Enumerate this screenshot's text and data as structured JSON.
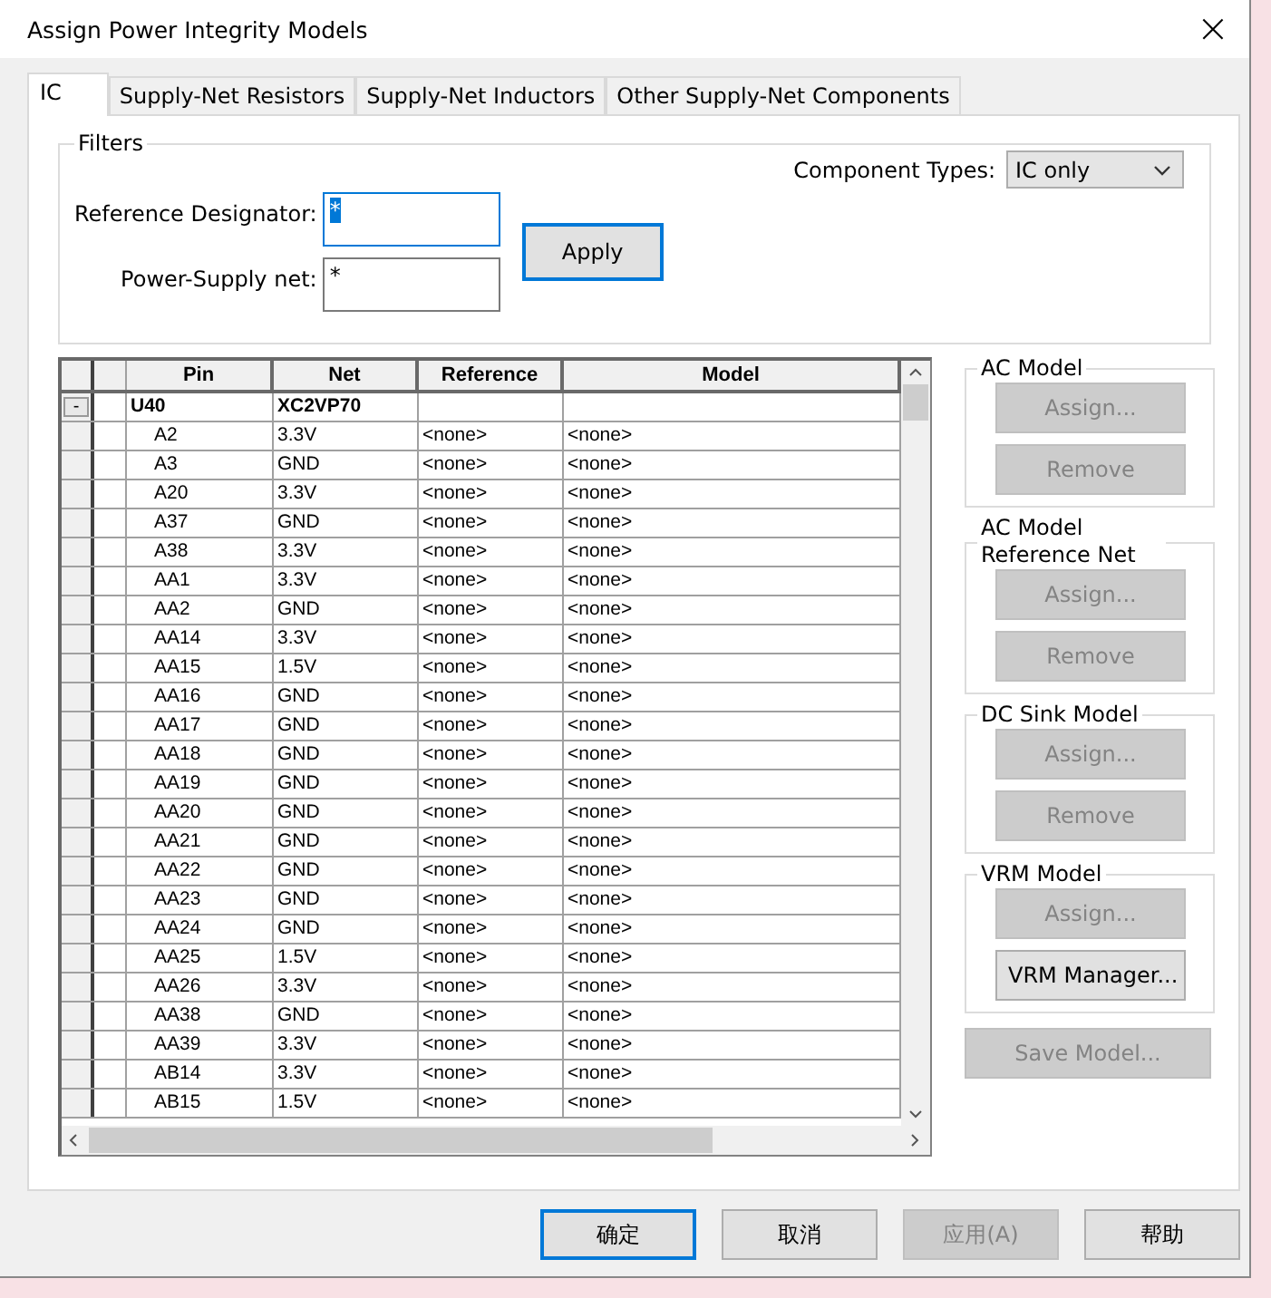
{
  "window": {
    "title": "Assign Power Integrity Models",
    "close": "×"
  },
  "tabs": [
    {
      "label": "IC",
      "selected": true
    },
    {
      "label": "Supply-Net Resistors",
      "selected": false
    },
    {
      "label": "Supply-Net Inductors",
      "selected": false
    },
    {
      "label": "Other Supply-Net Components",
      "selected": false
    }
  ],
  "filters": {
    "title": "Filters",
    "component_types_label": "Component Types:",
    "component_types_value": "IC only",
    "reference_designator_label": "Reference Designator:",
    "reference_designator_value": "*",
    "reference_designator_text_selected": true,
    "power_supply_net_label": "Power-Supply net:",
    "power_supply_net_value": "*",
    "apply": {
      "label": "Apply",
      "focused": true
    }
  },
  "table": {
    "columns": [
      "Pin",
      "Net",
      "Reference",
      "Model"
    ],
    "rows": [
      {
        "pin": "U40",
        "net": "XC2VP70",
        "reference": "",
        "model": "",
        "toggle": "-",
        "expanded": true,
        "children": [
          {
            "pin": "A2",
            "net": "3.3V",
            "reference": "<none>",
            "model": "<none>"
          },
          {
            "pin": "A3",
            "net": "GND",
            "reference": "<none>",
            "model": "<none>"
          },
          {
            "pin": "A20",
            "net": "3.3V",
            "reference": "<none>",
            "model": "<none>"
          },
          {
            "pin": "A37",
            "net": "GND",
            "reference": "<none>",
            "model": "<none>"
          },
          {
            "pin": "A38",
            "net": "3.3V",
            "reference": "<none>",
            "model": "<none>"
          },
          {
            "pin": "AA1",
            "net": "3.3V",
            "reference": "<none>",
            "model": "<none>"
          },
          {
            "pin": "AA2",
            "net": "GND",
            "reference": "<none>",
            "model": "<none>"
          },
          {
            "pin": "AA14",
            "net": "3.3V",
            "reference": "<none>",
            "model": "<none>"
          },
          {
            "pin": "AA15",
            "net": "1.5V",
            "reference": "<none>",
            "model": "<none>"
          },
          {
            "pin": "AA16",
            "net": "GND",
            "reference": "<none>",
            "model": "<none>"
          },
          {
            "pin": "AA17",
            "net": "GND",
            "reference": "<none>",
            "model": "<none>"
          },
          {
            "pin": "AA18",
            "net": "GND",
            "reference": "<none>",
            "model": "<none>"
          },
          {
            "pin": "AA19",
            "net": "GND",
            "reference": "<none>",
            "model": "<none>"
          },
          {
            "pin": "AA20",
            "net": "GND",
            "reference": "<none>",
            "model": "<none>"
          },
          {
            "pin": "AA21",
            "net": "GND",
            "reference": "<none>",
            "model": "<none>"
          },
          {
            "pin": "AA22",
            "net": "GND",
            "reference": "<none>",
            "model": "<none>"
          },
          {
            "pin": "AA23",
            "net": "GND",
            "reference": "<none>",
            "model": "<none>"
          },
          {
            "pin": "AA24",
            "net": "GND",
            "reference": "<none>",
            "model": "<none>"
          },
          {
            "pin": "AA25",
            "net": "1.5V",
            "reference": "<none>",
            "model": "<none>"
          },
          {
            "pin": "AA26",
            "net": "3.3V",
            "reference": "<none>",
            "model": "<none>"
          },
          {
            "pin": "AA38",
            "net": "GND",
            "reference": "<none>",
            "model": "<none>"
          },
          {
            "pin": "AA39",
            "net": "3.3V",
            "reference": "<none>",
            "model": "<none>"
          },
          {
            "pin": "AB14",
            "net": "3.3V",
            "reference": "<none>",
            "model": "<none>"
          },
          {
            "pin": "AB15",
            "net": "1.5V",
            "reference": "<none>",
            "model": "<none>"
          }
        ]
      }
    ]
  },
  "model_groups": [
    {
      "title": "AC Model",
      "buttons": [
        {
          "label": "Assign...",
          "disabled": true
        },
        {
          "label": "Remove",
          "disabled": true
        }
      ]
    },
    {
      "title": "AC Model Reference Net",
      "buttons": [
        {
          "label": "Assign...",
          "disabled": true
        },
        {
          "label": "Remove",
          "disabled": true
        }
      ]
    },
    {
      "title": "DC Sink Model",
      "buttons": [
        {
          "label": "Assign...",
          "disabled": true
        },
        {
          "label": "Remove",
          "disabled": true
        }
      ]
    },
    {
      "title": "VRM Model",
      "buttons": [
        {
          "label": "Assign...",
          "disabled": true
        },
        {
          "label": "VRM Manager...",
          "disabled": false
        }
      ]
    }
  ],
  "save_model": {
    "label": "Save Model...",
    "disabled": true
  },
  "footer_buttons": [
    {
      "label": "确定",
      "disabled": false,
      "focused": true
    },
    {
      "label": "取消",
      "disabled": false,
      "focused": false
    },
    {
      "label": "应用(A)",
      "disabled": true,
      "focused": false
    },
    {
      "label": "帮助",
      "disabled": false,
      "focused": false
    }
  ]
}
